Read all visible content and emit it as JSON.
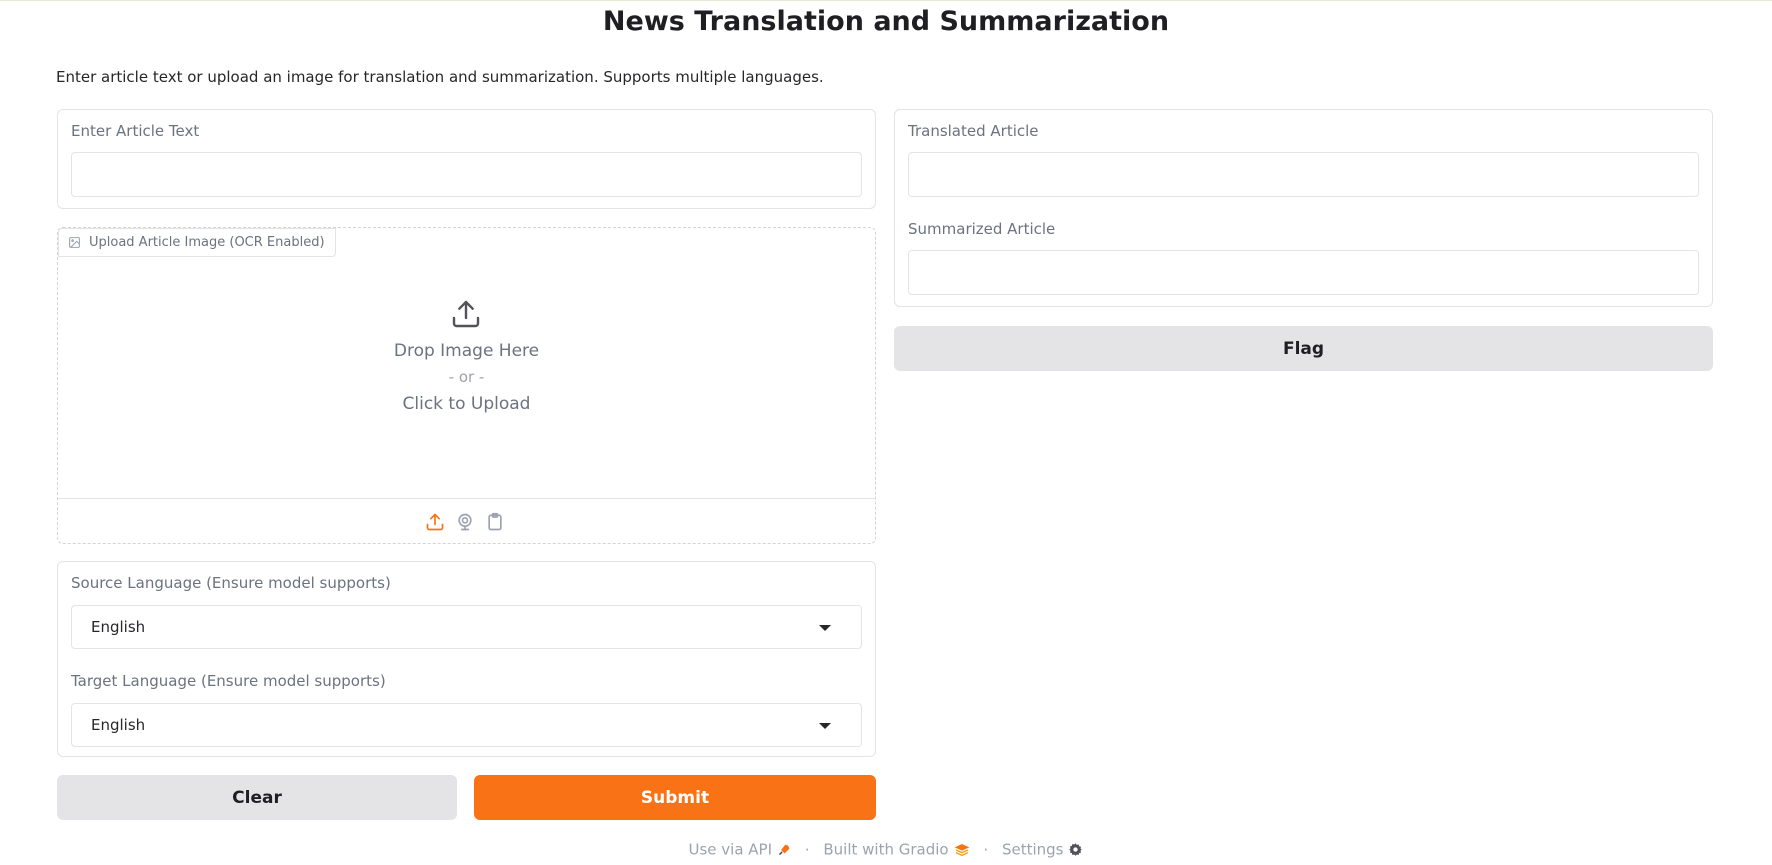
{
  "header": {
    "title": "News Translation and Summarization",
    "description": "Enter article text or upload an image for translation and summarization. Supports multiple languages."
  },
  "inputs": {
    "article_text": {
      "label": "Enter Article Text",
      "value": ""
    },
    "image_upload": {
      "label": "Upload Article Image (OCR Enabled)",
      "drop_text": "Drop Image Here",
      "or_text": "- or -",
      "click_text": "Click to Upload",
      "toolbar_icons": [
        "upload-icon",
        "webcam-icon",
        "clipboard-icon"
      ],
      "active_icon_color": "#f97316"
    },
    "source_language": {
      "label": "Source Language (Ensure model supports)",
      "value": "English"
    },
    "target_language": {
      "label": "Target Language (Ensure model supports)",
      "value": "English"
    }
  },
  "outputs": {
    "translated_article": {
      "label": "Translated Article",
      "value": ""
    },
    "summarized_article": {
      "label": "Summarized Article",
      "value": ""
    }
  },
  "actions": {
    "clear_label": "Clear",
    "submit_label": "Submit",
    "flag_label": "Flag",
    "primary_color": "#f97316"
  },
  "footer": {
    "api_label": "Use via API",
    "built_label": "Built with Gradio",
    "settings_label": "Settings",
    "separator": "·"
  }
}
